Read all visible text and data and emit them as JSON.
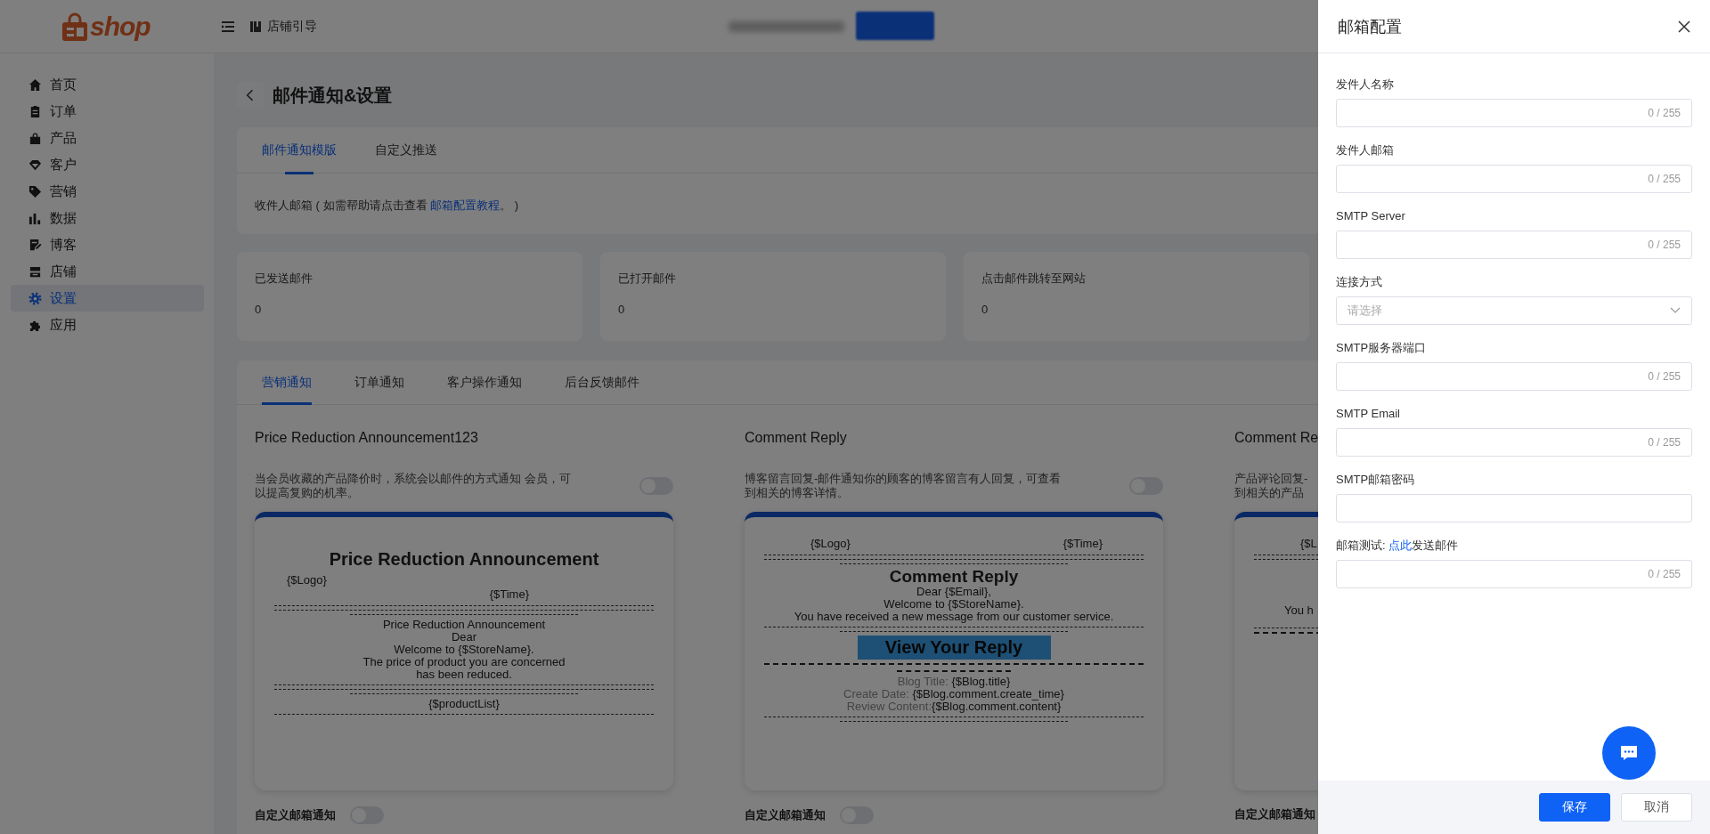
{
  "header": {
    "logo_text": "shop",
    "guide_link": "店铺引导"
  },
  "sidebar": {
    "items": [
      {
        "label": "首页",
        "selected": false
      },
      {
        "label": "订单",
        "selected": false
      },
      {
        "label": "产品",
        "selected": false
      },
      {
        "label": "客户",
        "selected": false
      },
      {
        "label": "营销",
        "selected": false
      },
      {
        "label": "数据",
        "selected": false
      },
      {
        "label": "博客",
        "selected": false
      },
      {
        "label": "店铺",
        "selected": false
      },
      {
        "label": "设置",
        "selected": true
      },
      {
        "label": "应用",
        "selected": false
      }
    ]
  },
  "page": {
    "title": "邮件通知&设置"
  },
  "template_card": {
    "tabs": [
      {
        "label": "邮件通知模版",
        "selected": true
      },
      {
        "label": "自定义推送",
        "selected": false
      }
    ],
    "note": {
      "before": "收件人邮箱 ( 如需帮助请点击查看 ",
      "link": "邮箱配置教程",
      "after": "。 )"
    }
  },
  "stats": [
    {
      "label": "已发送邮件",
      "value": "0"
    },
    {
      "label": "已打开邮件",
      "value": "0"
    },
    {
      "label": "点击邮件跳转至网站",
      "value": "0"
    }
  ],
  "notifications": {
    "tabs": [
      {
        "label": "营销通知",
        "selected": true
      },
      {
        "label": "订单通知",
        "selected": false
      },
      {
        "label": "客户操作通知",
        "selected": false
      },
      {
        "label": "后台反馈邮件",
        "selected": false
      }
    ],
    "templates": [
      {
        "title": "Price Reduction Announcement123",
        "description": [
          "当会员收藏的产品降价时，系统会以邮件的方式通知 会员，可",
          "以提高复购的机率。"
        ],
        "enabled": false,
        "preview": [
          {
            "kind": "heading",
            "text": "Price Reduction Announcement"
          },
          {
            "kind": "logo",
            "text": "{$Logo}"
          },
          {
            "kind": "time",
            "text": "{$Time}"
          },
          {
            "kind": "rule"
          },
          {
            "kind": "rule"
          },
          {
            "kind": "short_rule"
          },
          {
            "kind": "line",
            "text": "Price Reduction Announcement"
          },
          {
            "kind": "line",
            "text": "Dear"
          },
          {
            "kind": "line",
            "text": "Welcome to {$StoreName}."
          },
          {
            "kind": "line",
            "text": "The price of product you are concerned"
          },
          {
            "kind": "line",
            "text": "has been reduced."
          },
          {
            "kind": "rule"
          },
          {
            "kind": "rule"
          },
          {
            "kind": "short_rule"
          },
          {
            "kind": "line",
            "text": "{$productList}"
          },
          {
            "kind": "rule"
          }
        ],
        "custom_label": "自定义邮箱通知",
        "custom_enabled": false
      },
      {
        "title": "Comment Reply",
        "description": [
          "博客留言回复-邮件通知你的顾客的博客留言有人回复，可查看",
          "到相关的博客详情。"
        ],
        "enabled": false,
        "preview": [
          {
            "kind": "logo_time",
            "logo": "{$Logo}",
            "time": "{$Time}"
          },
          {
            "kind": "rule"
          },
          {
            "kind": "rule"
          },
          {
            "kind": "short_rule"
          },
          {
            "kind": "heading_small",
            "text": "Comment Reply"
          },
          {
            "kind": "line",
            "text": "Dear {$Email},"
          },
          {
            "kind": "line",
            "text": "Welcome to {$StoreName}."
          },
          {
            "kind": "line",
            "text": "You have received a new message from our customer service."
          },
          {
            "kind": "rule"
          },
          {
            "kind": "short_rule"
          },
          {
            "kind": "button",
            "text": "View Your Reply"
          },
          {
            "kind": "thick_rule"
          },
          {
            "kind": "thick_short_rule"
          },
          {
            "kind": "field",
            "label": "Blog Title: ",
            "value": "{$Blog.title}"
          },
          {
            "kind": "field",
            "label": "Create Date: ",
            "value": "{$Blog.comment.create_time}"
          },
          {
            "kind": "field",
            "label": "Review Content:",
            "value": "{$Blog.comment.content}"
          },
          {
            "kind": "rule"
          },
          {
            "kind": "short_rule"
          }
        ],
        "custom_label": "自定义邮箱通知",
        "custom_enabled": false
      },
      {
        "title": "Comment Re",
        "description": [
          "产品评论回复-",
          "到相关的产品"
        ],
        "preview": [
          {
            "kind": "logo_time",
            "logo": "{$L"
          },
          {
            "kind": "rule"
          },
          {
            "kind": "rule"
          },
          {
            "kind": "clipped_line",
            "text": "You h"
          },
          {
            "kind": "rule"
          },
          {
            "kind": "thick_rule"
          }
        ],
        "custom_label": "自定义邮箱通知"
      }
    ]
  },
  "drawer": {
    "title": "邮箱配置",
    "fields": [
      {
        "kind": "text",
        "label": "发件人名称",
        "counter": "0 / 255"
      },
      {
        "kind": "text",
        "label": "发件人邮箱",
        "counter": "0 / 255"
      },
      {
        "kind": "text",
        "label": "SMTP Server",
        "counter": "0 / 255"
      },
      {
        "kind": "select",
        "label": "连接方式",
        "placeholder": "请选择"
      },
      {
        "kind": "text",
        "label": "SMTP服务器端口",
        "counter": "0 / 255"
      },
      {
        "kind": "text",
        "label": "SMTP Email",
        "counter": "0 / 255"
      },
      {
        "kind": "password",
        "label": "SMTP邮箱密码"
      },
      {
        "kind": "text",
        "label": "邮箱测试: ",
        "link": "点此",
        "label_after": "发送邮件",
        "counter": "0 / 255"
      }
    ],
    "buttons": [
      {
        "label": "保存",
        "kind": "primary"
      },
      {
        "label": "取消",
        "kind": "default"
      }
    ]
  }
}
